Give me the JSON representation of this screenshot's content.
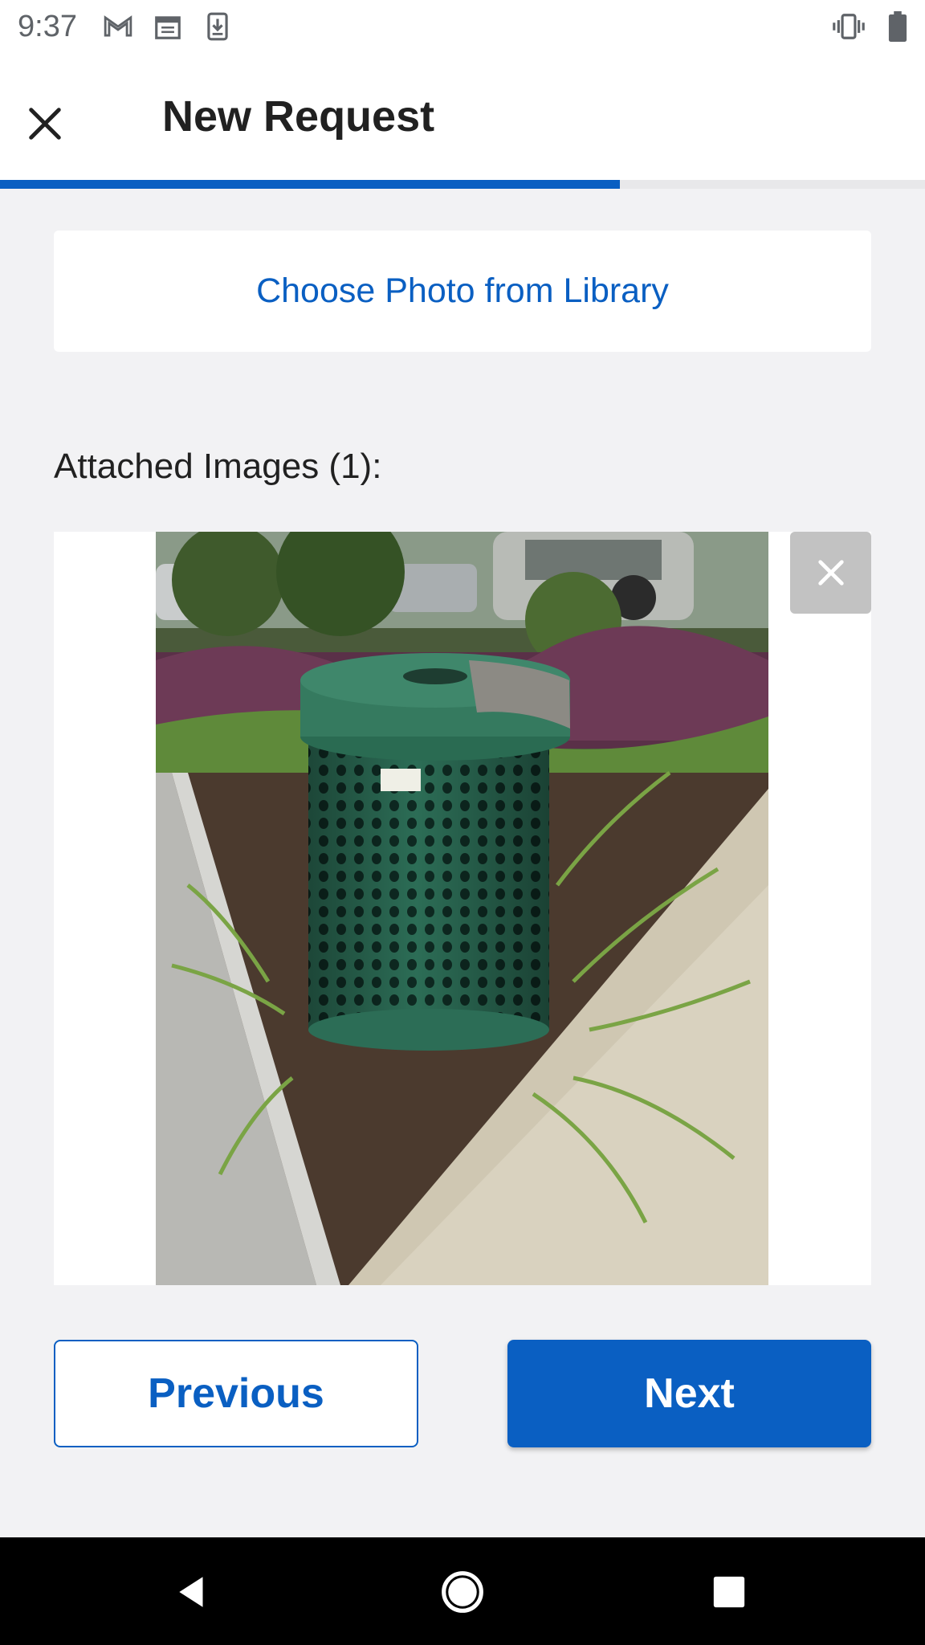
{
  "status_bar": {
    "time": "9:37",
    "icons_left": [
      "gmail-icon",
      "calendar-icon",
      "download-icon"
    ],
    "icons_right": [
      "vibrate-icon",
      "battery-icon"
    ]
  },
  "app_bar": {
    "title": "New Request",
    "close_icon": "close-icon"
  },
  "progress": {
    "fraction": 0.67,
    "color": "#0a5fc2"
  },
  "choose_photo": {
    "label": "Choose Photo from Library"
  },
  "attachments": {
    "label": "Attached Images (1):",
    "count": 1,
    "items": [
      {
        "alt": "green trash bin among plants",
        "remove_icon": "close-icon"
      }
    ]
  },
  "actions": {
    "previous_label": "Previous",
    "next_label": "Next"
  },
  "nav_bar": {
    "items": [
      "back-icon",
      "home-icon",
      "recents-icon"
    ]
  },
  "colors": {
    "accent": "#0a5fc2",
    "background": "#f2f2f4",
    "remove_button": "#c2c2c2"
  }
}
